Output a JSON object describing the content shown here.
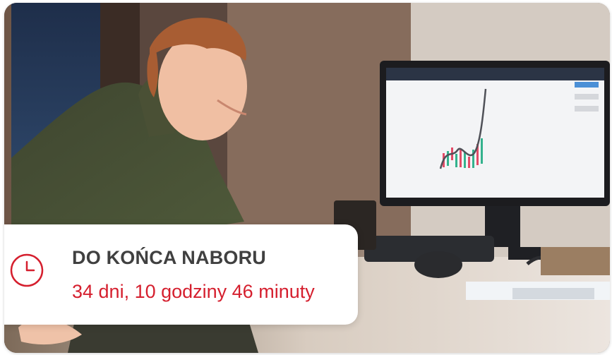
{
  "hero": {
    "image_description": "Man at desk smiling at monitor showing trading chart",
    "icons": {
      "clock": "clock-icon"
    },
    "colors": {
      "accent": "#d51f2e",
      "title_text": "#404040",
      "panel_bg": "#ffffff"
    }
  },
  "countdown": {
    "title": "DO KOŃCA NABORU",
    "remaining": "34 dni, 10 godziny 46 minuty"
  }
}
